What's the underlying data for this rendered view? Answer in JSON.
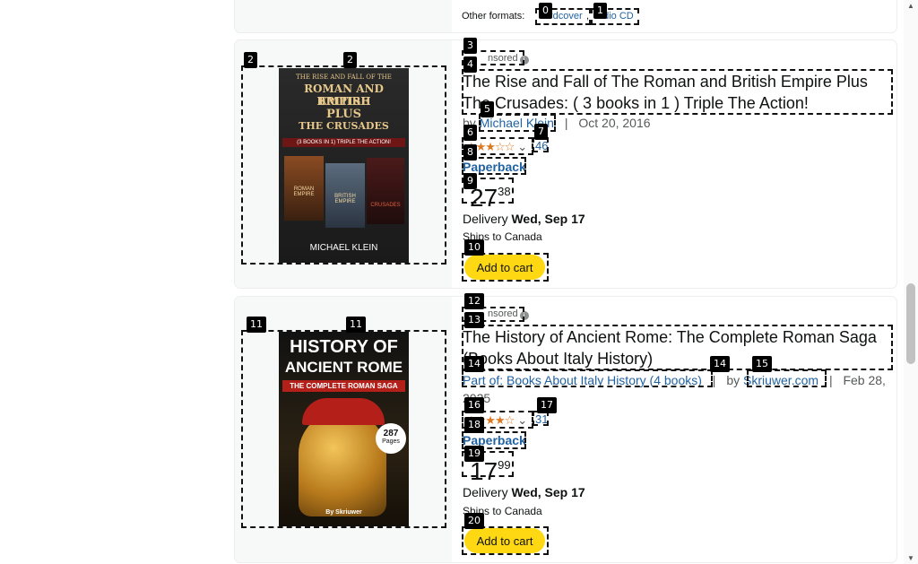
{
  "top_card": {
    "other_formats_label": "Other formats:",
    "formats": [
      "rdcover",
      "udio CD"
    ],
    "separator": ","
  },
  "products": [
    {
      "sponsored": "nsored",
      "title": "The Rise and Fall of The Roman and British Empire Plus The Crusades: ( 3 books in 1 ) Triple The Action!",
      "by_prefix": "by",
      "author": "Michael Klein",
      "date_sep": "|",
      "date": "Oct 20, 2016",
      "stars": "★★★☆☆",
      "rating": 3.3,
      "rating_count": "46",
      "format": "Paperback",
      "price_dollars": "27",
      "price_cents": "38",
      "delivery_label": "Delivery",
      "delivery_date": "Wed, Sep 17",
      "ships": "Ships to Canada",
      "cart_label": "Add to cart",
      "cover": {
        "line1": "THE RISE AND FALL OF THE",
        "line2": "ROMAN AND BRITISH",
        "line3": "EMPIRE",
        "line4": "PLUS",
        "line5": "THE CRUSADES",
        "banner": "(3 BOOKS IN 1) TRIPLE THE ACTION!",
        "book_a": "ROMAN EMPIRE",
        "book_b": "BRITISH EMPIRE",
        "book_c": "CRUSADES",
        "author": "MICHAEL KLEIN"
      }
    },
    {
      "sponsored": "nsored",
      "title": "The History of Ancient Rome: The Complete Roman Saga (Books About Italy History)",
      "series": "Part of: Books About Italy History (4 books)",
      "series_sep": "|",
      "by_prefix": "by",
      "author": "Skriuwer.com",
      "date_sep": "|",
      "date": "Feb 28, 2025",
      "stars": "★★★★☆",
      "rating": 3.6,
      "rating_count": "31",
      "format": "Paperback",
      "price_dollars": "17",
      "price_cents": "99",
      "delivery_label": "Delivery",
      "delivery_date": "Wed, Sep 17",
      "ships": "Ships to Canada",
      "cart_label": "Add to cart",
      "cover": {
        "line1": "HISTORY OF",
        "line2": "ANCIENT ROME",
        "line3": "THE COMPLETE ROMAN SAGA",
        "pages_num": "287",
        "pages_label": "Pages",
        "author": "By Skriuwer"
      }
    }
  ],
  "tags": [
    "0",
    "1",
    "2",
    "2",
    "3",
    "4",
    "5",
    "6",
    "7",
    "8",
    "9",
    "10",
    "11",
    "11",
    "12",
    "13",
    "14",
    "14",
    "15",
    "16",
    "17",
    "18",
    "19",
    "20"
  ],
  "colors": {
    "cart": "#ffd814",
    "link": "#2162a1",
    "star": "#de7921"
  }
}
